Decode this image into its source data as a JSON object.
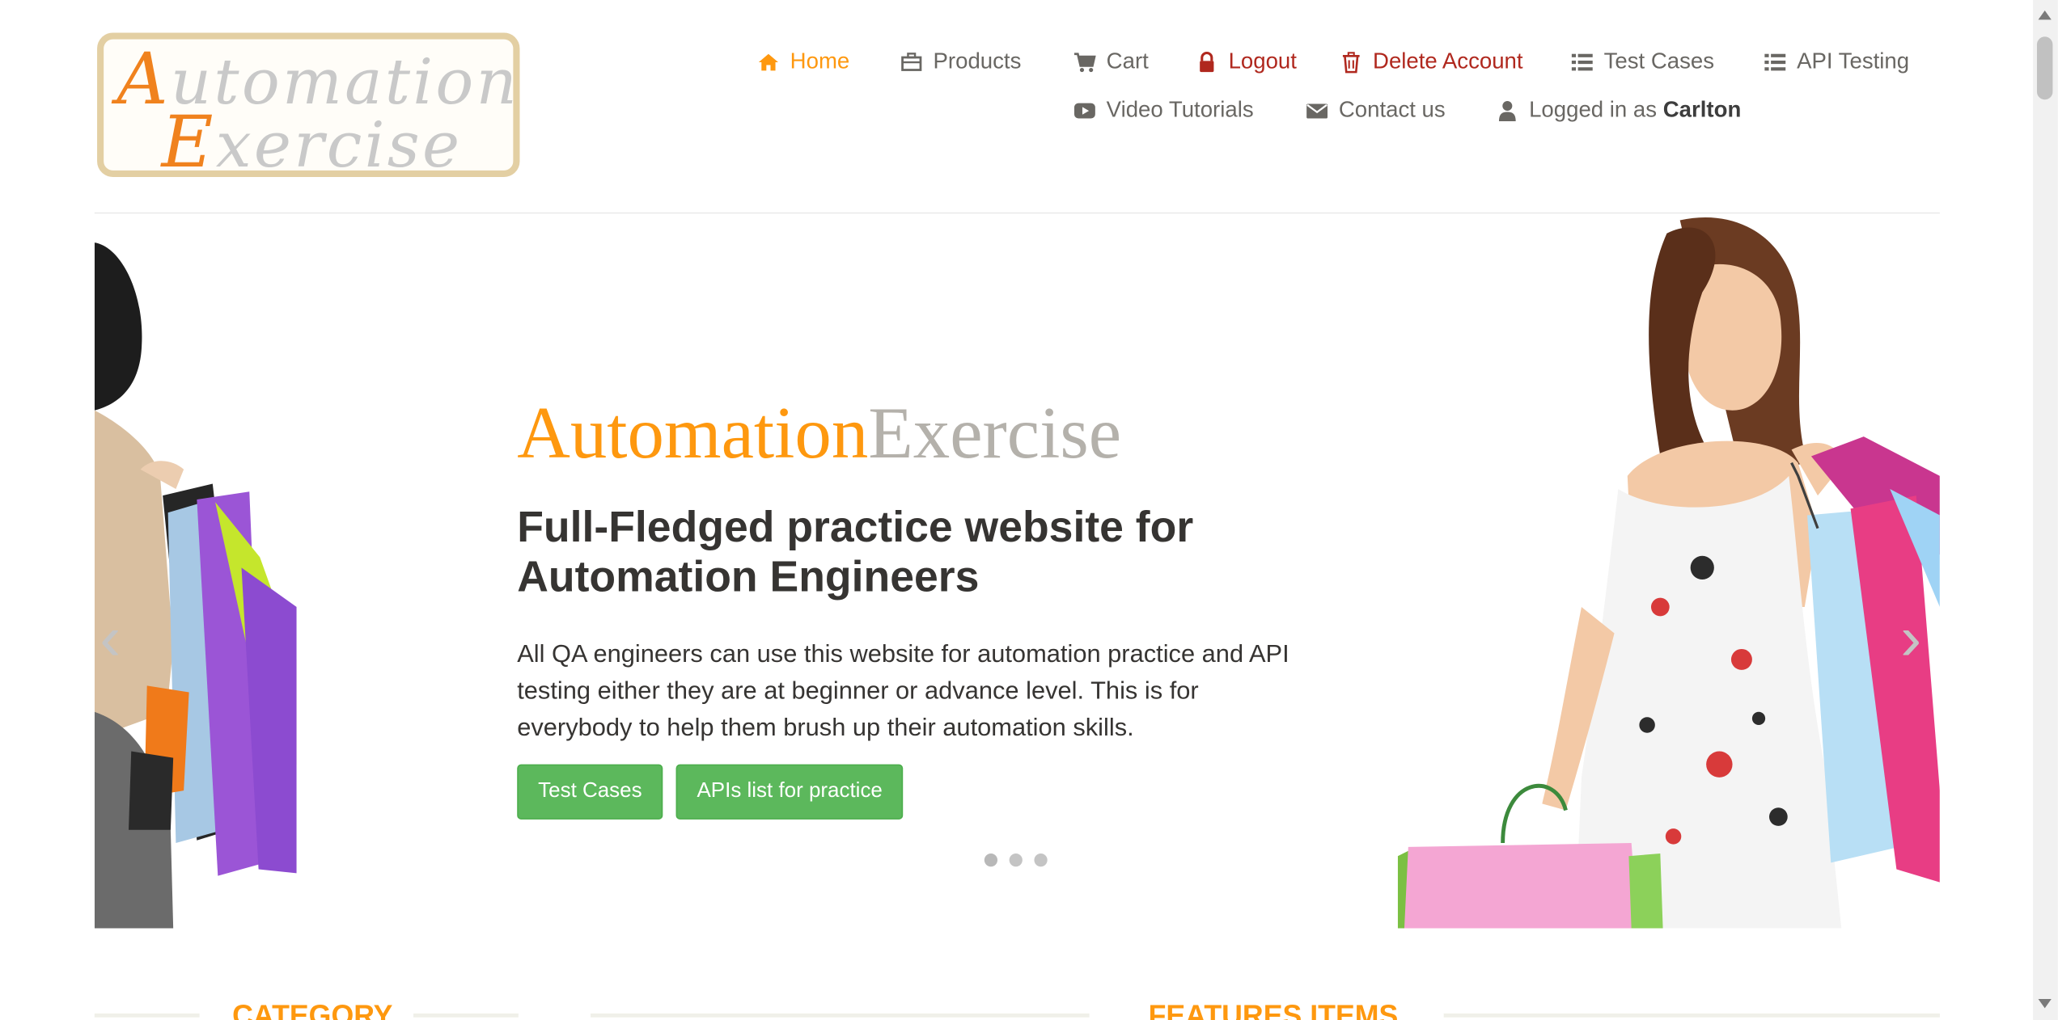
{
  "header": {
    "logo": {
      "line1": "Automation",
      "line2": "Exercise"
    },
    "nav": [
      {
        "label": "Home",
        "icon": "home-icon",
        "state": "active"
      },
      {
        "label": "Products",
        "icon": "briefcase-icon"
      },
      {
        "label": "Cart",
        "icon": "cart-icon"
      },
      {
        "label": "Logout",
        "icon": "lock-icon"
      },
      {
        "label": "Delete Account",
        "icon": "trash-icon"
      },
      {
        "label": "Test Cases",
        "icon": "list-icon"
      },
      {
        "label": "API Testing",
        "icon": "list-icon"
      },
      {
        "label": "Video Tutorials",
        "icon": "youtube-play-icon"
      },
      {
        "label": "Contact us",
        "icon": "envelope-icon"
      },
      {
        "label_prefix": "Logged in as",
        "username": "Carlton",
        "icon": "user-icon"
      }
    ]
  },
  "slider": {
    "brand_primary": "Automation",
    "brand_secondary": "Exercise",
    "headline": "Full-Fledged practice website for Automation Engineers",
    "description": "All QA engineers can use this website for automation practice and API testing either they are at beginner or advance level. This is for everybody to help them brush up their automation skills.",
    "buttons": [
      "Test Cases",
      "APIs list for practice"
    ],
    "slide_count": 3,
    "active_slide": 1,
    "prev_arrow": "‹",
    "next_arrow": "›"
  },
  "sections": {
    "category_title": "CATEGORY",
    "features_title": "FEATURES ITEMS"
  },
  "colors": {
    "accent": "#FE980F",
    "danger": "#B0281E",
    "button": "#5CB85C",
    "text": "#696763",
    "heading": "#363432"
  }
}
